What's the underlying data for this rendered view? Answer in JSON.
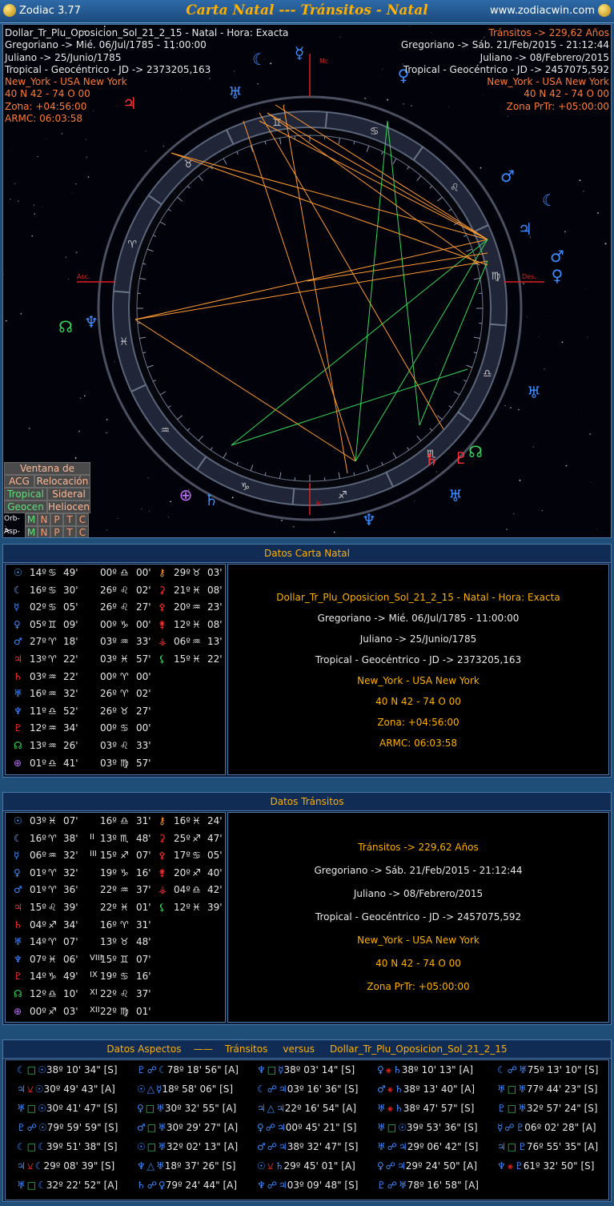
{
  "app": {
    "name": "Zodiac 3.77",
    "title": "Carta Natal --- Tránsitos - Natal",
    "site": "www.zodiacwin.com"
  },
  "chart_info": {
    "left": [
      "Dollar_Tr_Plu_Oposicion_Sol_21_2_15 - Natal - Hora: Exacta",
      "Gregoriano -> Mié. 06/Jul/1785 - 11:00:00",
      "Juliano -> 25/Junio/1785",
      "Tropical - Geocéntrico - JD -> 2373205,163",
      "New_York - USA New York",
      "40 N 42 - 74 O 00",
      "Zona: +04:56:00",
      "ARMC: 06:03:58"
    ],
    "right": [
      "Tránsitos -> 229,62 Años",
      "Gregoriano -> Sáb. 21/Feb/2015 - 21:12:44",
      "Juliano -> 08/Febrero/2015",
      "Tropical - Geocéntrico - JD -> 2457075,592",
      "New_York - USA New York",
      "40 N 42 - 74 O 00",
      "Zona PrTr: +05:00:00"
    ]
  },
  "axes": {
    "mc": "Mc",
    "asc": "Asc.",
    "des": "Des.",
    "ic": "Ic"
  },
  "side_buttons": {
    "ventana": "Ventana de Ciclos",
    "acg": "ACG",
    "relocacion": "Relocación",
    "tropical": "Tropical",
    "sideral": "Sideral",
    "geocen": "Geocen",
    "heliocen": "Heliocen",
    "orb_label": "Orb->",
    "asp_label": "Asp->",
    "letters": [
      "M",
      "N",
      "P",
      "T",
      "C"
    ]
  },
  "natal": {
    "header": "Datos Carta Natal",
    "rows": [
      [
        "14º",
        "♋",
        "49'",
        "00º",
        "♎",
        "00'"
      ],
      [
        "16º",
        "♋",
        "30'",
        "26º",
        "♌",
        "02'"
      ],
      [
        "02º",
        "♋",
        "05'",
        "26º",
        "♌",
        "27'"
      ],
      [
        "05º",
        "♊",
        "09'",
        "00º",
        "♑",
        "00'"
      ],
      [
        "27º",
        "♈",
        "18'",
        "03º",
        "♒",
        "33'"
      ],
      [
        "13º",
        "♈",
        "22'",
        "03º",
        "♓",
        "57'"
      ],
      [
        "03º",
        "♒",
        "22'",
        "00º",
        "♈",
        "00'"
      ],
      [
        "16º",
        "♒",
        "32'",
        "26º",
        "♈",
        "02'"
      ],
      [
        "11º",
        "♎",
        "52'",
        "26º",
        "♉",
        "27'"
      ],
      [
        "12º",
        "♒",
        "34'",
        "00º",
        "♋",
        "00'"
      ],
      [
        "13º",
        "♒",
        "26'",
        "03º",
        "♌",
        "33'"
      ],
      [
        "01º",
        "♎",
        "41'",
        "03º",
        "♍",
        "57'"
      ]
    ],
    "extra": [
      [
        "29º",
        "♉",
        "03'"
      ],
      [
        "21º",
        "♓",
        "08'"
      ],
      [
        "20º",
        "♒",
        "23'"
      ],
      [
        "12º",
        "♓",
        "08'"
      ],
      [
        "06º",
        "♒",
        "13'"
      ],
      [
        "15º",
        "♓",
        "22'"
      ]
    ],
    "glyphs": [
      "☉",
      "☾",
      "☿",
      "♀",
      "♂",
      "♃",
      "♄",
      "♅",
      "♆",
      "♇",
      "☊",
      "⊕"
    ],
    "extra_glyphs": [
      "⚷",
      "⚳",
      "⚴",
      "⚵",
      "⚶",
      "⚸"
    ],
    "desc": [
      "Dollar_Tr_Plu_Oposicion_Sol_21_2_15 - Natal - Hora: Exacta",
      "Gregoriano -> Mié. 06/Jul/1785 - 11:00:00",
      "Juliano -> 25/Junio/1785",
      "Tropical - Geocéntrico - JD -> 2373205,163",
      "New_York - USA New York",
      "40 N 42 - 74 O 00",
      "Zona: +04:56:00",
      "ARMC: 06:03:58"
    ]
  },
  "transits": {
    "header": "Datos Tránsitos",
    "rows": [
      [
        "03º",
        "♓",
        "07'",
        "16º",
        "♎",
        "31'"
      ],
      [
        "16º",
        "♈",
        "38'",
        "13º",
        "♏",
        "48'"
      ],
      [
        "06º",
        "♒",
        "32'",
        "15º",
        "♐",
        "07'"
      ],
      [
        "01º",
        "♈",
        "32'",
        "19º",
        "♑",
        "16'"
      ],
      [
        "01º",
        "♈",
        "36'",
        "22º",
        "♒",
        "37'"
      ],
      [
        "15º",
        "♌",
        "39'",
        "22º",
        "♓",
        "01'"
      ],
      [
        "04º",
        "♐",
        "34'",
        "16º",
        "♈",
        "31'"
      ],
      [
        "14º",
        "♈",
        "07'",
        "13º",
        "♉",
        "48'"
      ],
      [
        "07º",
        "♓",
        "06'",
        "15º",
        "♊",
        "07'"
      ],
      [
        "14º",
        "♑",
        "49'",
        "19º",
        "♋",
        "16'"
      ],
      [
        "12º",
        "♎",
        "10'",
        "22º",
        "♌",
        "37'"
      ],
      [
        "00º",
        "♐",
        "03'",
        "22º",
        "♍",
        "01'"
      ]
    ],
    "house_prefix": [
      "",
      "II",
      "III",
      "",
      "",
      "",
      "",
      "",
      "VIII",
      "IX",
      "XI",
      "XII"
    ],
    "extra": [
      [
        "16º",
        "♓",
        "24'"
      ],
      [
        "25º",
        "♐",
        "47'"
      ],
      [
        "17º",
        "♋",
        "05'"
      ],
      [
        "20º",
        "♐",
        "40'"
      ],
      [
        "04º",
        "♎",
        "42'"
      ],
      [
        "12º",
        "♓",
        "39'"
      ]
    ],
    "desc": [
      "Tránsitos -> 229,62 Años",
      "Gregoriano -> Sáb. 21/Feb/2015 - 21:12:44",
      "Juliano -> 08/Febrero/2015",
      "Tropical - Geocéntrico - JD -> 2457075,592",
      "New_York - USA New York",
      "40 N 42 - 74 O 00",
      "Zona PrTr: +05:00:00"
    ]
  },
  "aspects": {
    "header_a": "Datos Aspectos",
    "header_b": "Tránsitos",
    "header_c": "versus",
    "header_d": "Dollar_Tr_Plu_Oposicion_Sol_21_2_15",
    "cells": [
      [
        "☾",
        "□",
        "☉",
        "38º 10' 34\" [S]"
      ],
      [
        "♇",
        "☍",
        "☾",
        "78º 18' 56\" [A]"
      ],
      [
        "♆",
        "□",
        "☿",
        "38º 03' 14\" [S]"
      ],
      [
        "♀",
        "⚹",
        "♄",
        "38º 10' 13\" [A]"
      ],
      [
        "☾",
        "☍",
        "♅",
        "75º 13' 10\" [S]"
      ],
      [
        "♃",
        "⚺",
        "☉",
        "30º 49' 43\" [A]"
      ],
      [
        "☉",
        "△",
        "☿",
        "18º 58' 06\" [S]"
      ],
      [
        "☾",
        "☍",
        "♃",
        "03º 16' 36\" [S]"
      ],
      [
        "♂",
        "⚹",
        "♄",
        "38º 13' 40\" [A]"
      ],
      [
        "♅",
        "□",
        "♅",
        "77º 44' 23\" [S]"
      ],
      [
        "♅",
        "□",
        "☉",
        "30º 41' 47\" [S]"
      ],
      [
        "♀",
        "□",
        "♅",
        "30º 32' 55\" [A]"
      ],
      [
        "♃",
        "△",
        "♃",
        "22º 16' 54\" [A]"
      ],
      [
        "♅",
        "⚹",
        "♄",
        "38º 47' 57\" [S]"
      ],
      [
        "♇",
        "□",
        "♅",
        "32º 57' 24\" [S]"
      ],
      [
        "♇",
        "☍",
        "☉",
        "79º 59' 59\" [S]"
      ],
      [
        "♂",
        "□",
        "♅",
        "30º 29' 27\" [A]"
      ],
      [
        "♀",
        "☍",
        "♃",
        "00º 45' 21\" [S]"
      ],
      [
        "♅",
        "□",
        "☉",
        "39º 53' 36\" [S]"
      ],
      [
        "☿",
        "☍",
        "♇",
        "06º 02' 28\" [A]"
      ],
      [
        "☾",
        "□",
        "☾",
        "39º 51' 38\" [S]"
      ],
      [
        "☉",
        "□",
        "♅",
        "32º 02' 13\" [A]"
      ],
      [
        "♂",
        "☍",
        "♃",
        "38º 32' 47\" [S]"
      ],
      [
        "♅",
        "☍",
        "♃",
        "29º 06' 42\" [S]"
      ],
      [
        "♃",
        "□",
        "♇",
        "76º 55' 35\" [A]"
      ],
      [
        "♃",
        "⚺",
        "☾",
        "29º 08' 39\" [S]"
      ],
      [
        "♆",
        "△",
        "♅",
        "18º 37' 26\" [S]"
      ],
      [
        "☉",
        "⚺",
        "♄",
        "29º 45' 01\" [A]"
      ],
      [
        "♀",
        "☍",
        "♃",
        "29º 24' 50\" [A]"
      ],
      [
        "♆",
        "⚹",
        "♇",
        "61º 32' 50\" [S]"
      ],
      [
        "♅",
        "□",
        "☾",
        "32º 22' 52\" [A]"
      ],
      [
        "♄",
        "☍",
        "♀",
        "79º 24' 44\" [A]"
      ],
      [
        "♆",
        "☍",
        "♃",
        "03º 09' 48\" [S]"
      ],
      [
        "♇",
        "☍",
        "♅",
        "78º 16' 58\" [A]"
      ],
      [
        "",
        "",
        "",
        ""
      ]
    ]
  },
  "wheel": {
    "signs": [
      "♈",
      "♉",
      "♊",
      "♋",
      "♌",
      "♍",
      "♎",
      "♏",
      "♐",
      "♑",
      "♒",
      "♓"
    ],
    "natal_planets": [
      {
        "g": "♂",
        "c": "#3d8cff"
      },
      {
        "g": "☾",
        "c": "#3d8cff"
      },
      {
        "g": "♃",
        "c": "#3d8cff"
      },
      {
        "g": "♂",
        "c": "#3d8cff"
      },
      {
        "g": "♀",
        "c": "#3d8cff"
      },
      {
        "g": "♅",
        "c": "#3d8cff"
      },
      {
        "g": "♄",
        "c": "#ff3030"
      },
      {
        "g": "☊",
        "c": "#35d85a"
      },
      {
        "g": "♇",
        "c": "#ff3030"
      },
      {
        "g": "♅",
        "c": "#3d8cff"
      },
      {
        "g": "♆",
        "c": "#3d8cff"
      },
      {
        "g": "♄",
        "c": "#3d8cff"
      },
      {
        "g": "⊕",
        "c": "#c070ff"
      },
      {
        "g": "♆",
        "c": "#3d8cff"
      },
      {
        "g": "☊",
        "c": "#35d85a"
      },
      {
        "g": "♅",
        "c": "#3d8cff"
      },
      {
        "g": "☿",
        "c": "#3d8cff"
      },
      {
        "g": "♀",
        "c": "#3d8cff"
      },
      {
        "g": "♃",
        "c": "#ff3030"
      },
      {
        "g": "☾",
        "c": "#3d8cff"
      }
    ]
  }
}
